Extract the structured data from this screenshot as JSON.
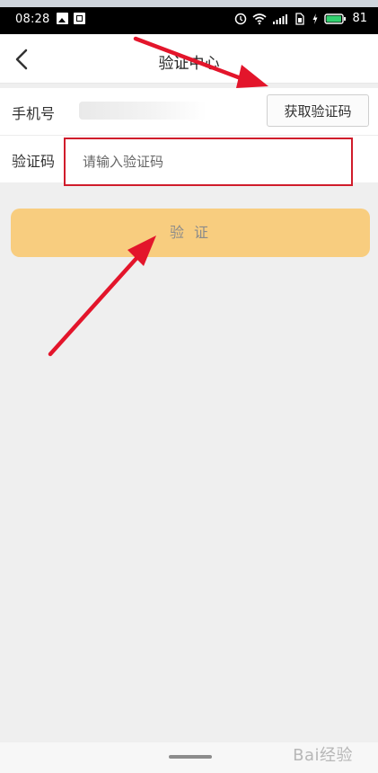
{
  "status": {
    "time": "08:28",
    "battery": "81"
  },
  "header": {
    "title": "验证中心"
  },
  "form": {
    "phone_label": "手机号",
    "get_code_label": "获取验证码",
    "code_label": "验证码",
    "code_placeholder": "请输入验证码"
  },
  "actions": {
    "verify_label": "验 证"
  },
  "watermark": {
    "text": "Bai经验"
  },
  "colors": {
    "accent": "#f8cd7f",
    "highlight": "#d01c2b"
  }
}
